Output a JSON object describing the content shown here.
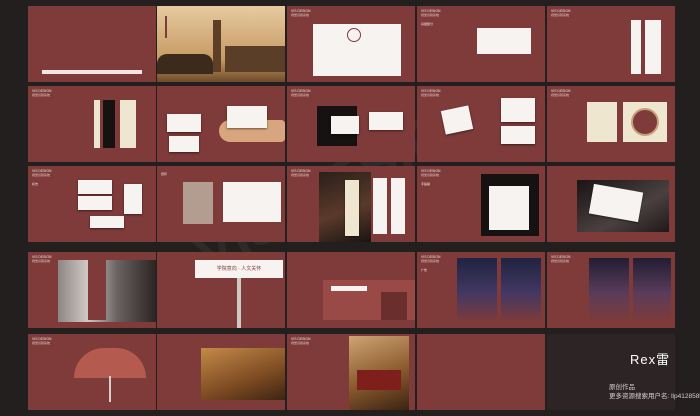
{
  "header": {
    "code": "VIS DESIGN",
    "subtitle": "视觉识别系统"
  },
  "footer": {
    "brand": "Rex雷",
    "note_line1": "原创作品",
    "note_line2": "更多资源搜索用户名: llp412858569"
  },
  "billboard": {
    "slogan": "学院意向 · 人文关怀"
  },
  "labels": {
    "s1": "基础部分",
    "s2": "应用部分",
    "s3": "标志",
    "s4": "纸杯",
    "s5": "手提袋",
    "s6": "名片",
    "s7": "门头",
    "s8": "广告"
  },
  "colors": {
    "accent": "#7e3b3a",
    "background": "#231f1f",
    "cream": "#efe6cf"
  }
}
